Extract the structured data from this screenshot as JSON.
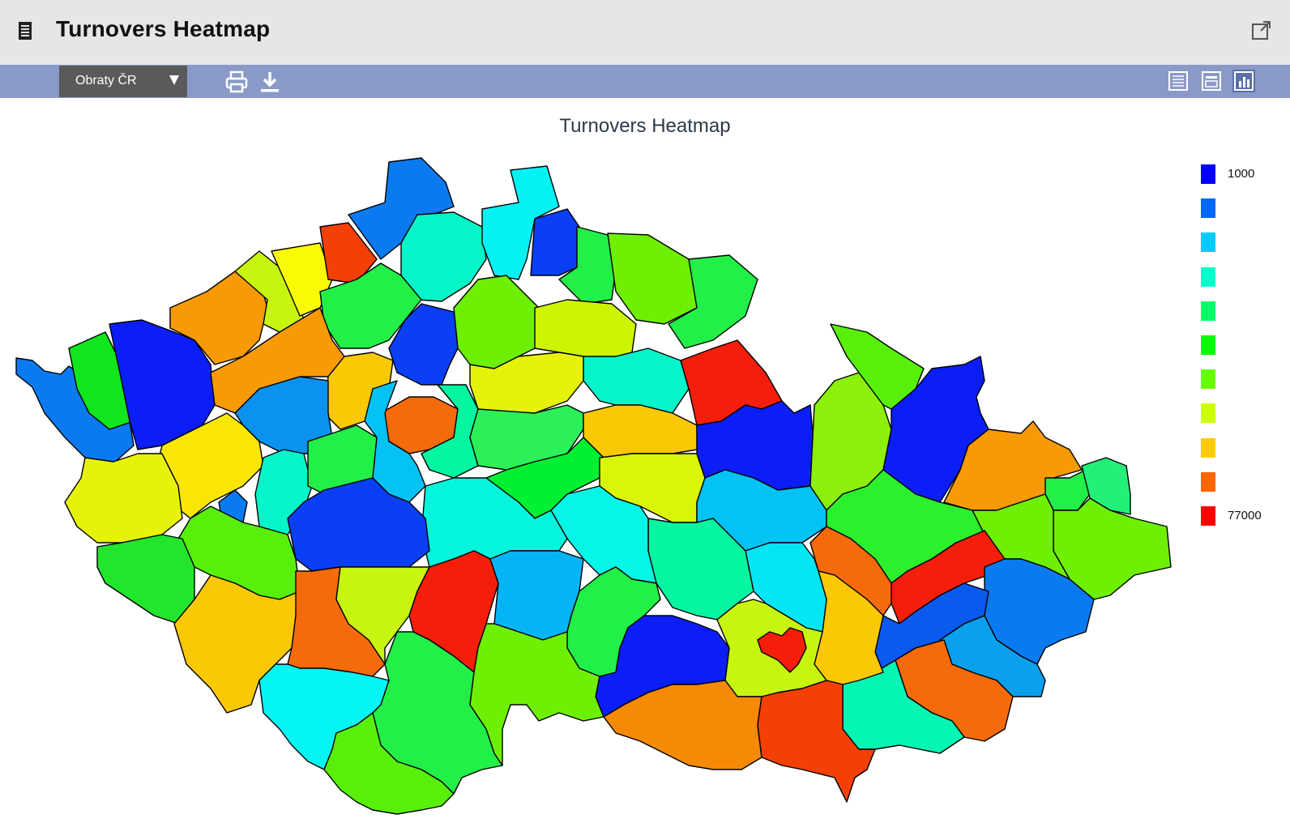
{
  "header": {
    "title": "Turnovers Heatmap"
  },
  "toolbar": {
    "dataset_select": "Obraty ČR"
  },
  "chart": {
    "title": "Turnovers Heatmap"
  },
  "legend": {
    "min_label": "1000",
    "max_label": "77000",
    "colors": [
      "#0000ff",
      "#0066ff",
      "#00ccff",
      "#00ffcc",
      "#00ff66",
      "#00ff00",
      "#66ff00",
      "#ccff00",
      "#ffcc00",
      "#ff6600",
      "#ff0000"
    ]
  },
  "chart_data": {
    "type": "heatmap",
    "title": "Turnovers Heatmap",
    "legend_range": [
      1000,
      77000
    ],
    "color_scale": [
      "blue",
      "light-blue",
      "cyan",
      "aqua",
      "mint",
      "green",
      "lime",
      "yellow-green",
      "amber",
      "orange",
      "red"
    ]
  }
}
